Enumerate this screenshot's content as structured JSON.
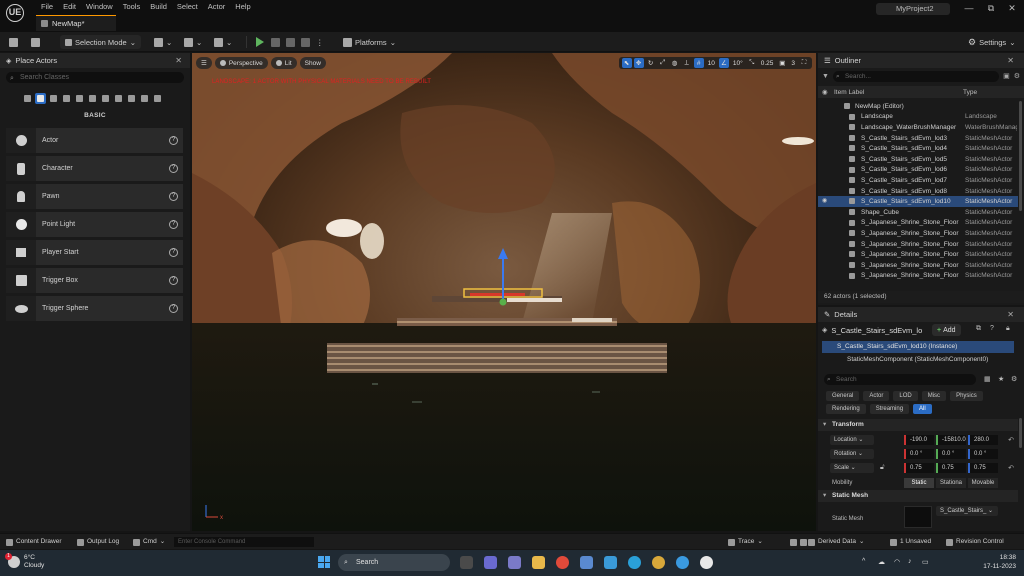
{
  "titlebar": {
    "logo": "UE",
    "menu": [
      "File",
      "Edit",
      "Window",
      "Tools",
      "Build",
      "Select",
      "Actor",
      "Help"
    ],
    "tab_label": "NewMap*",
    "project_name": "MyProject2",
    "window_buttons": [
      "—",
      "⧉",
      "✕"
    ]
  },
  "toolbar": {
    "selection_mode": "Selection Mode",
    "platforms": "Platforms",
    "settings": "Settings"
  },
  "place_actors": {
    "title": "Place Actors",
    "search_placeholder": "Search Classes",
    "section": "BASIC",
    "items": [
      {
        "label": "Actor",
        "icon": "sphere-icon"
      },
      {
        "label": "Character",
        "icon": "character-icon"
      },
      {
        "label": "Pawn",
        "icon": "pawn-icon"
      },
      {
        "label": "Point Light",
        "icon": "light-bulb-icon"
      },
      {
        "label": "Player Start",
        "icon": "flag-icon"
      },
      {
        "label": "Trigger Box",
        "icon": "cube-icon"
      },
      {
        "label": "Trigger Sphere",
        "icon": "sphere-icon"
      }
    ]
  },
  "viewport": {
    "perspective": "Perspective",
    "lit": "Lit",
    "show": "Show",
    "grid_snap": "10",
    "rot_snap": "10°",
    "scale_snap": "0.25",
    "camera_speed": "3",
    "warning": "LANDSCAPE: 1 ACTOR WITH PHYSICAL MATERIALS NEED TO BE REBUILT"
  },
  "outliner": {
    "title": "Outliner",
    "search_placeholder": "Search...",
    "col_label": "Item Label",
    "col_type": "Type",
    "root": "NewMap (Editor)",
    "rows": [
      {
        "label": "Landscape",
        "type": "Landscape"
      },
      {
        "label": "Landscape_WaterBrushManager",
        "type": "WaterBrushManager"
      },
      {
        "label": "S_Castle_Stairs_sdEvm_lod3",
        "type": "StaticMeshActor"
      },
      {
        "label": "S_Castle_Stairs_sdEvm_lod4",
        "type": "StaticMeshActor"
      },
      {
        "label": "S_Castle_Stairs_sdEvm_lod5",
        "type": "StaticMeshActor"
      },
      {
        "label": "S_Castle_Stairs_sdEvm_lod6",
        "type": "StaticMeshActor"
      },
      {
        "label": "S_Castle_Stairs_sdEvm_lod7",
        "type": "StaticMeshActor"
      },
      {
        "label": "S_Castle_Stairs_sdEvm_lod8",
        "type": "StaticMeshActor"
      },
      {
        "label": "S_Castle_Stairs_sdEvm_lod10",
        "type": "StaticMeshActor"
      },
      {
        "label": "Shape_Cube",
        "type": "StaticMeshActor"
      },
      {
        "label": "S_Japanese_Shrine_Stone_Floor",
        "type": "StaticMeshActor"
      },
      {
        "label": "S_Japanese_Shrine_Stone_Floor",
        "type": "StaticMeshActor"
      },
      {
        "label": "S_Japanese_Shrine_Stone_Floor",
        "type": "StaticMeshActor"
      },
      {
        "label": "S_Japanese_Shrine_Stone_Floor",
        "type": "StaticMeshActor"
      },
      {
        "label": "S_Japanese_Shrine_Stone_Floor",
        "type": "StaticMeshActor"
      },
      {
        "label": "S_Japanese_Shrine_Stone_Floor",
        "type": "StaticMeshActor"
      }
    ],
    "selected_index": 8,
    "footer": "62 actors (1 selected)"
  },
  "details": {
    "title": "Details",
    "actor_name": "S_Castle_Stairs_sdEvm_lo",
    "add_label": "Add",
    "instance": "S_Castle_Stairs_sdEvm_lod10 (Instance)",
    "component": "StaticMeshComponent (StaticMeshComponent0)",
    "search_placeholder": "Search",
    "tabs_row1": [
      "General",
      "Actor",
      "LOD",
      "Misc",
      "Physics"
    ],
    "tabs_row2": [
      "Rendering",
      "Streaming",
      "All"
    ],
    "active_tab": "All",
    "transform_section": "Transform",
    "location_label": "Location",
    "location": [
      "-190.0",
      "-15810.0",
      "280.0"
    ],
    "rotation_label": "Rotation",
    "rotation": [
      "0.0 °",
      "0.0 °",
      "0.0 °"
    ],
    "scale_label": "Scale",
    "scale": [
      "0.75",
      "0.75",
      "0.75"
    ],
    "mobility_label": "Mobility",
    "mobility_options": [
      "Static",
      "Stationa",
      "Movable"
    ],
    "static_mesh_section": "Static Mesh",
    "static_mesh_label": "Static Mesh",
    "static_mesh_value": "S_Castle_Stairs_"
  },
  "bottombar": {
    "content_drawer": "Content Drawer",
    "output_log": "Output Log",
    "cmd": "Cmd",
    "console_placeholder": "Enter Console Command",
    "trace": "Trace",
    "derived_data": "Derived Data",
    "unsaved": "1 Unsaved",
    "revision_control": "Revision Control"
  },
  "taskbar": {
    "temp": "6°C",
    "weather": "Cloudy",
    "weather_badge": "1",
    "search": "Search",
    "time": "18:38",
    "date": "17-11-2023"
  }
}
